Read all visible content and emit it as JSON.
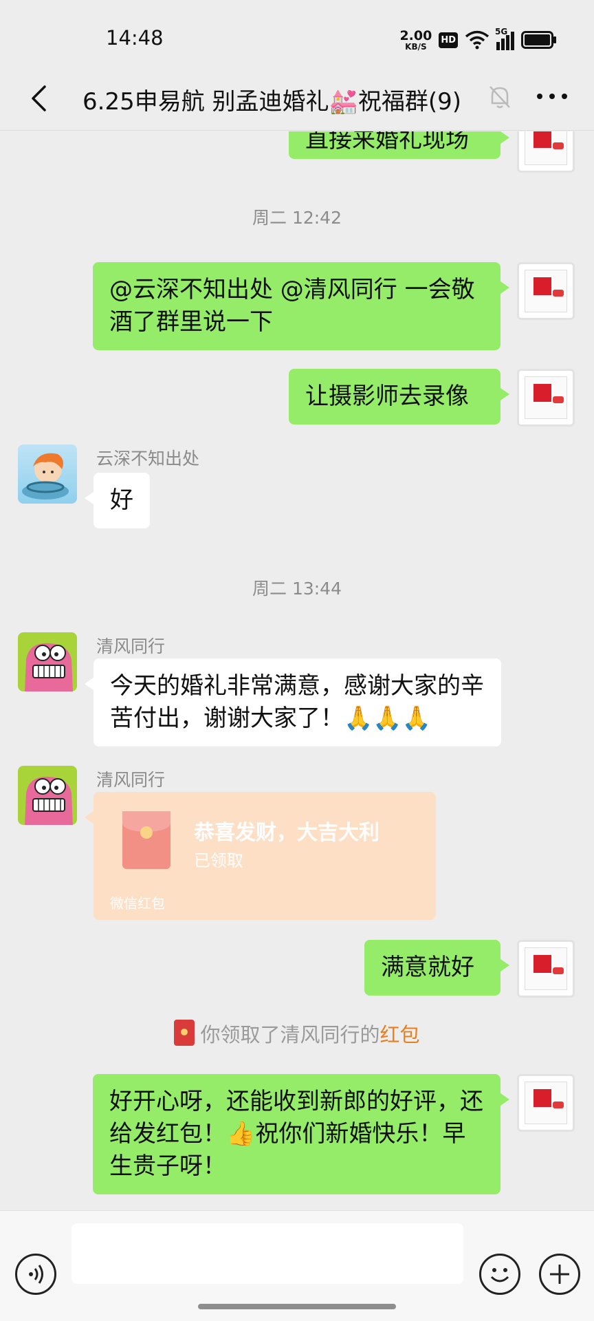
{
  "status_bar": {
    "time": "14:48",
    "net_speed_value": "2.00",
    "net_speed_unit": "KB/S",
    "hd_badge": "HD",
    "signal": "5G",
    "icons": [
      "wifi-icon",
      "signal-icon",
      "battery-icon"
    ]
  },
  "header": {
    "title": "6.25申易航 别孟迪婚礼💒祝福群(9)",
    "icons": [
      "back-icon",
      "mute-icon",
      "more-icon"
    ]
  },
  "messages": {
    "m0_partial": "直接来婚礼现场",
    "ts1": "周二 12:42",
    "m1": "@云深不知出处 @清风同行  一会敬酒了群里说一下",
    "m2": "让摄影师去录像",
    "m3_sender": "云深不知出处",
    "m3": "好",
    "ts2": "周二 13:44",
    "m4_sender": "清风同行",
    "m4": "今天的婚礼非常满意，感谢大家的辛苦付出，谢谢大家了！🙏🙏🙏",
    "m5_sender": "清风同行",
    "red_packet": {
      "title": "恭喜发财，大吉大利",
      "status": "已领取",
      "footer": "微信红包"
    },
    "m6": "满意就好",
    "system_notice": {
      "prefix": "你领取了清风同行的",
      "link": "红包"
    },
    "m7": "好开心呀，还能收到新郎的好评，还给发红包！👍祝你们新婚快乐！早生贵子呀！"
  },
  "input_bar": {
    "icons": [
      "voice-icon",
      "emoji-icon",
      "plus-icon"
    ]
  },
  "colors": {
    "my_bubble": "#95ec69",
    "other_bubble": "#ffffff",
    "background": "#ededed",
    "red_packet": "#fddfc6",
    "link": "#e67e22"
  }
}
